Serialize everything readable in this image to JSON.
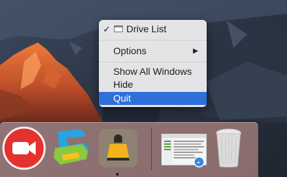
{
  "menu": {
    "items": [
      {
        "label": "Drive List",
        "checked": true,
        "icon": "window-icon"
      },
      {
        "label": "Options",
        "submenu": true
      },
      {
        "label": "Show All Windows"
      },
      {
        "label": "Hide"
      },
      {
        "label": "Quit",
        "highlighted": true
      }
    ],
    "checkmark": "✓",
    "submenu_arrow": "▶"
  },
  "dock": {
    "apps": [
      {
        "name": "zoom-app-icon"
      },
      {
        "name": "snagit-app-icon"
      },
      {
        "name": "drive-list-app-icon",
        "running": true
      },
      {
        "name": "mail-window-thumbnail"
      },
      {
        "name": "safari-badge-icon"
      },
      {
        "name": "trash-icon"
      }
    ]
  },
  "colors": {
    "highlight": "#2f6fd8",
    "zoom_red": "#e5312f",
    "dock_tint": "#d79e96"
  }
}
